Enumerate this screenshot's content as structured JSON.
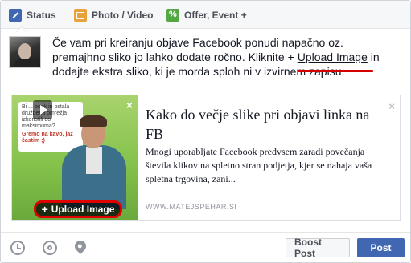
{
  "tabs": [
    {
      "label": "Status",
      "icon": "pencil-icon"
    },
    {
      "label": "Photo / Video",
      "icon": "camera-icon"
    },
    {
      "label": "Offer, Event +",
      "icon": "offer-icon"
    }
  ],
  "message": {
    "line1": "Če vam pri kreiranju objave Facebook ponudi napačno oz.",
    "line2_pre": "premajhno sliko jo lahko dodate ročno. Kliknite + ",
    "link": "Upload Image",
    "line2_post": " in",
    "line3": "dodajte ekstra sliko, ki je morda sploh ni v izvirnem zapisu."
  },
  "preview": {
    "title": "Kako do večje slike pri objavi linka na FB",
    "description": "Mnogi uporabljate Facebook predvsem zaradi povečanja števila klikov na spletno stran podjetja, kjer se nahaja vaša spletna trgovina, zani...",
    "domain": "WWW.MATEJSPEHAR.SI",
    "thumb_text": "Bi ... book in ostala družbena omrežja izkoristili do maksimuma?",
    "thumb_text_red": "Gremo na kavo, jaz častim ;)",
    "upload_label": "Upload Image",
    "close_glyph": "×"
  },
  "footer": {
    "boost_label": "Boost Post",
    "post_label": "Post"
  },
  "colors": {
    "primary": "#4267b2",
    "highlight": "#d60000"
  }
}
